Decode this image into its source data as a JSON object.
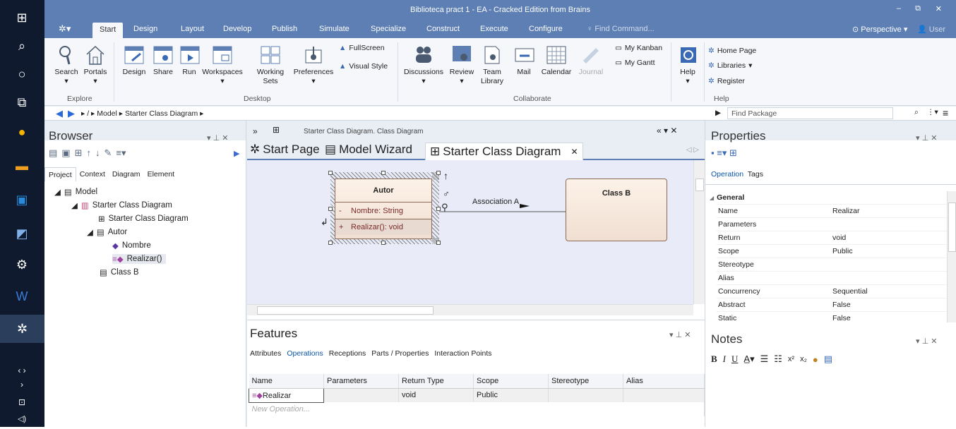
{
  "window": {
    "title": "Biblioteca pract 1 - EA - Cracked Edition from Brains",
    "perspective": "Perspective",
    "user": "User",
    "min": "–",
    "restore": "⧉",
    "close": "✕"
  },
  "menu_tabs": [
    "Start",
    "Design",
    "Layout",
    "Develop",
    "Publish",
    "Simulate",
    "Specialize",
    "Construct",
    "Execute",
    "Configure"
  ],
  "find_command": "Find Command...",
  "ribbon": {
    "explore": {
      "label": "Explore",
      "search": "Search",
      "portals": "Portals"
    },
    "desktop": {
      "label": "Desktop",
      "design": "Design",
      "share": "Share",
      "run": "Run",
      "workspaces": "Workspaces",
      "working_sets": "Working Sets",
      "preferences": "Preferences",
      "fullscreen": "FullScreen",
      "visual_style": "Visual Style"
    },
    "collaborate": {
      "label": "Collaborate",
      "discussions": "Discussions",
      "review": "Review",
      "team_library": "Team Library",
      "mail": "Mail",
      "calendar": "Calendar",
      "journal": "Journal",
      "my_kanban": "My Kanban",
      "my_gantt": "My Gantt"
    },
    "help": {
      "label": "Help",
      "help": "Help",
      "home_page": "Home Page",
      "libraries": "Libraries",
      "register": "Register"
    }
  },
  "navbar": {
    "sep": "/",
    "crumb_model": "Model",
    "crumb_diagram": "Starter Class Diagram",
    "find_package": "Find Package"
  },
  "browser": {
    "title": "Browser",
    "tabs": [
      "Project",
      "Context",
      "Diagram",
      "Element"
    ],
    "tree": {
      "model": "Model",
      "pkg": "Starter Class Diagram",
      "diagram": "Starter Class Diagram",
      "autor": "Autor",
      "nombre": "Nombre",
      "realizar": "Realizar()",
      "classb": "Class B"
    }
  },
  "diagram": {
    "caption": "Starter Class Diagram.  Class Diagram",
    "tabs": {
      "start": "Start Page",
      "wizard": "Model Wizard",
      "starter": "Starter Class Diagram"
    },
    "autor": {
      "name": "Autor",
      "attr_vis": "-",
      "attr": "Nombre: String",
      "op_vis": "+",
      "op": "Realizar(): void"
    },
    "classb": {
      "name": "Class B"
    },
    "association": "Association A"
  },
  "features": {
    "title": "Features",
    "tabs": [
      "Attributes",
      "Operations",
      "Receptions",
      "Parts / Properties",
      "Interaction Points"
    ],
    "columns": [
      "Name",
      "Parameters",
      "Return Type",
      "Scope",
      "Stereotype",
      "Alias"
    ],
    "rows": [
      {
        "name": "Realizar",
        "params": "",
        "return": "void",
        "scope": "Public",
        "stereotype": "",
        "alias": ""
      }
    ],
    "new_row": "New Operation..."
  },
  "properties": {
    "title": "Properties",
    "tabs": [
      "Operation",
      "Tags"
    ],
    "section": "General",
    "rows": [
      [
        "Name",
        "Realizar"
      ],
      [
        "Parameters",
        ""
      ],
      [
        "Return",
        "void"
      ],
      [
        "Scope",
        "Public"
      ],
      [
        "Stereotype",
        ""
      ],
      [
        "Alias",
        ""
      ],
      [
        "Concurrency",
        "Sequential"
      ],
      [
        "Abstract",
        "False"
      ],
      [
        "Static",
        "False"
      ]
    ]
  },
  "notes": {
    "title": "Notes"
  },
  "colors": {
    "accent": "#5d7fb4",
    "panel": "#e9eef5",
    "classfill": "#f5e6da",
    "canvas": "#e9ecf8"
  }
}
